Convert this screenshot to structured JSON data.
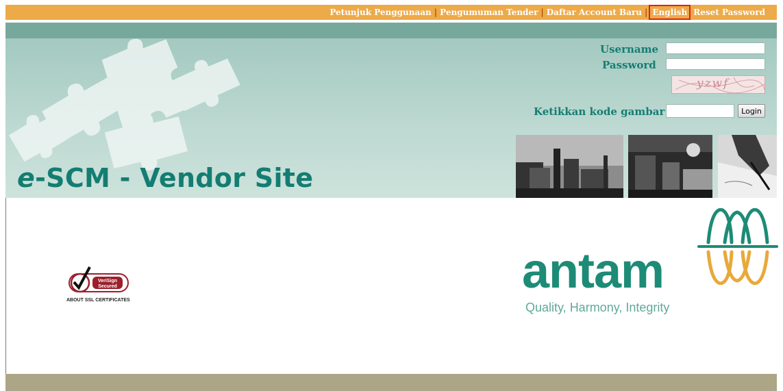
{
  "nav": {
    "items": [
      "Petunjuk Penggunaan",
      "Pengumuman Tender",
      "Daftar Account Baru",
      "English",
      "Reset Password"
    ],
    "active_index": 3
  },
  "banner": {
    "title_prefix": "e",
    "title_rest": "-SCM - Vendor Site"
  },
  "login": {
    "username_label": "Username",
    "password_label": "Password",
    "captcha_text": "yzwf",
    "captcha_label": "Ketikkan kode gambar",
    "login_button": "Login"
  },
  "verisign": {
    "line1": "VeriSign",
    "line2": "Secured",
    "caption": "ABOUT SSL CERTIFICATES"
  },
  "brand": {
    "name": "antam",
    "tagline": "Quality, Harmony, Integrity"
  },
  "colors": {
    "nav_bg": "#edaa48",
    "teal": "#147d72",
    "footer": "#aca586"
  }
}
